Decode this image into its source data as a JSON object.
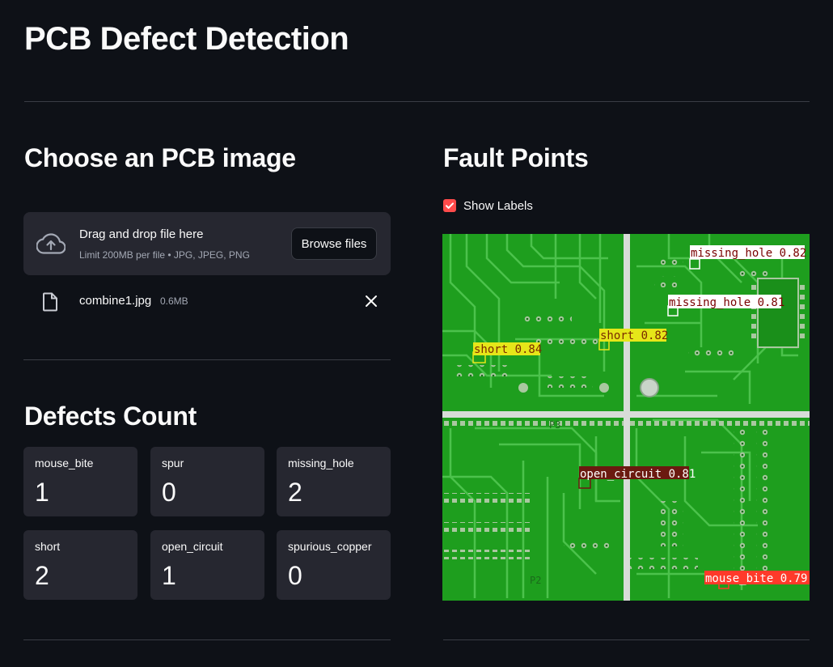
{
  "page": {
    "title": "PCB Defect Detection"
  },
  "upload": {
    "heading": "Choose an PCB image",
    "drag_text": "Drag and drop file here",
    "limit_text": "Limit 200MB per file • JPG, JPEG, PNG",
    "browse_label": "Browse files",
    "file": {
      "name": "combine1.jpg",
      "size": "0.6MB"
    }
  },
  "defects": {
    "heading": "Defects Count",
    "items": [
      {
        "label": "mouse_bite",
        "value": "1"
      },
      {
        "label": "spur",
        "value": "0"
      },
      {
        "label": "missing_hole",
        "value": "2"
      },
      {
        "label": "short",
        "value": "2"
      },
      {
        "label": "open_circuit",
        "value": "1"
      },
      {
        "label": "spurious_copper",
        "value": "0"
      }
    ]
  },
  "fault": {
    "heading": "Fault Points",
    "show_labels": {
      "label": "Show Labels",
      "checked": true
    },
    "detections": [
      {
        "label": "missing_hole 0.82",
        "color": "#ffffff"
      },
      {
        "label": "missing_hole 0.81",
        "color": "#ffffff"
      },
      {
        "label": "short 0.82",
        "color": "#e6e619"
      },
      {
        "label": "short 0.84",
        "color": "#e6e619"
      },
      {
        "label": "open_circuit 0.81",
        "color": "#6b1a10"
      },
      {
        "label": "mouse_bite 0.79",
        "color": "#ff3a2a"
      }
    ],
    "board_marks": [
      "P3",
      "P2"
    ]
  },
  "colors": {
    "background": "#0e1117",
    "card": "#262730",
    "accent": "#ff4b4b",
    "pcb_green": "#1e9e1e"
  }
}
